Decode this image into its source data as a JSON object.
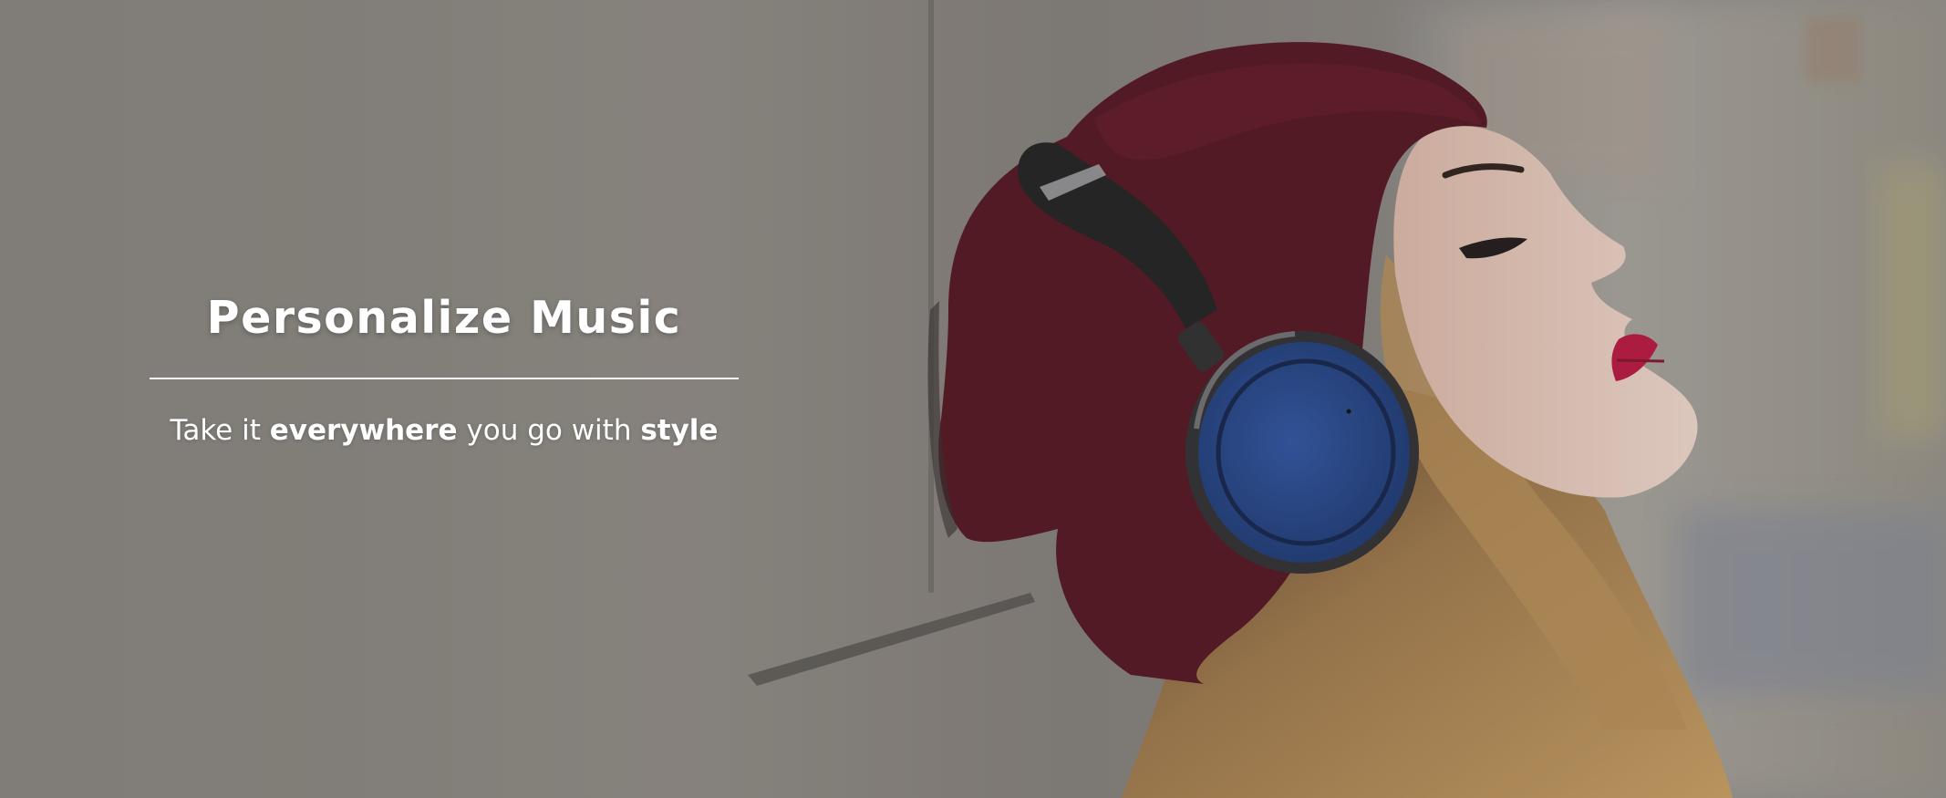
{
  "banner": {
    "headline": "Personalize Music",
    "tagline": [
      {
        "text": "Take it ",
        "emphasis": false
      },
      {
        "text": "everywhere",
        "emphasis": true
      },
      {
        "text": " you go with ",
        "emphasis": false
      },
      {
        "text": "style",
        "emphasis": true
      }
    ]
  },
  "colors": {
    "overlay_tint": "#6f6a66",
    "beanie": "#5a1020",
    "headphone_band": "#1c1c1e",
    "headphone_cup": "#1f3f86",
    "lips": "#b5123c",
    "hair": "#b88a4e",
    "skin": "#e9cfc4",
    "text": "#ffffff"
  },
  "photo": {
    "subject": "woman-with-headphones-leaning-on-wall"
  }
}
